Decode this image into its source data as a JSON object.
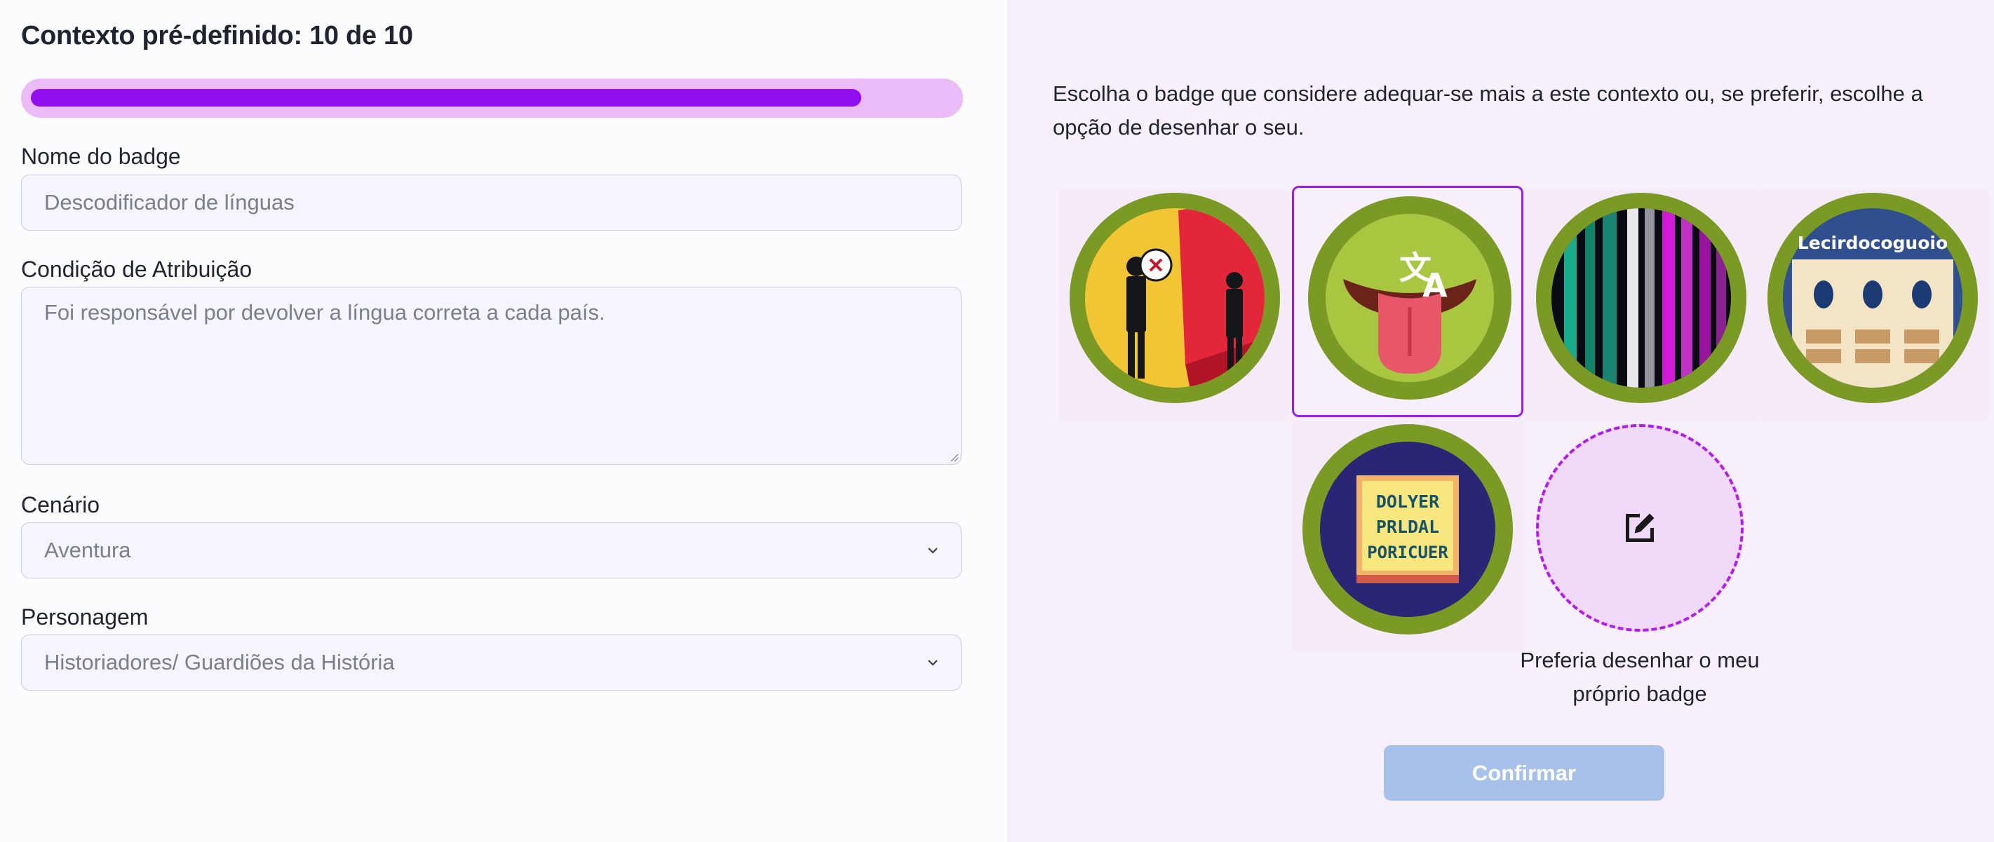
{
  "context": {
    "title": "Contexto pré-definido: 10 de 10",
    "progress_fraction": 0.9
  },
  "form": {
    "badge_name": {
      "label": "Nome do badge",
      "placeholder": "Descodificador de línguas"
    },
    "condition": {
      "label": "Condição de Atribuição",
      "placeholder": "Foi responsável por devolver a língua correta a cada país."
    },
    "scenario": {
      "label": "Cenário",
      "value": "Aventura"
    },
    "character": {
      "label": "Personagem",
      "value": "Historiadores/ Guardiões da História"
    }
  },
  "picker": {
    "intro": "Escolha o badge que considere adequar-se mais a este contexto ou, se preferir, escolhe a opção de desenhar o seu.",
    "badges": [
      {
        "icon": "mirror-figures-badge-icon",
        "selected": false
      },
      {
        "icon": "translate-tongue-badge-icon",
        "selected": true
      },
      {
        "icon": "binary-code-badge-icon",
        "selected": false
      },
      {
        "icon": "lesson-board-badge-icon",
        "selected": false,
        "text": "Lecirdocoguoio"
      },
      {
        "icon": "pixel-sign-badge-icon",
        "selected": false,
        "text": [
          "DOLYER",
          "PRLDAL",
          "PORICUER"
        ]
      }
    ],
    "draw_own_label": "Preferia desenhar o meu próprio badge",
    "confirm_label": "Confirmar"
  },
  "colors": {
    "accent": "#9210ef",
    "badge_ring": "#7b9a25",
    "confirm_disabled": "#a7c1ea"
  }
}
